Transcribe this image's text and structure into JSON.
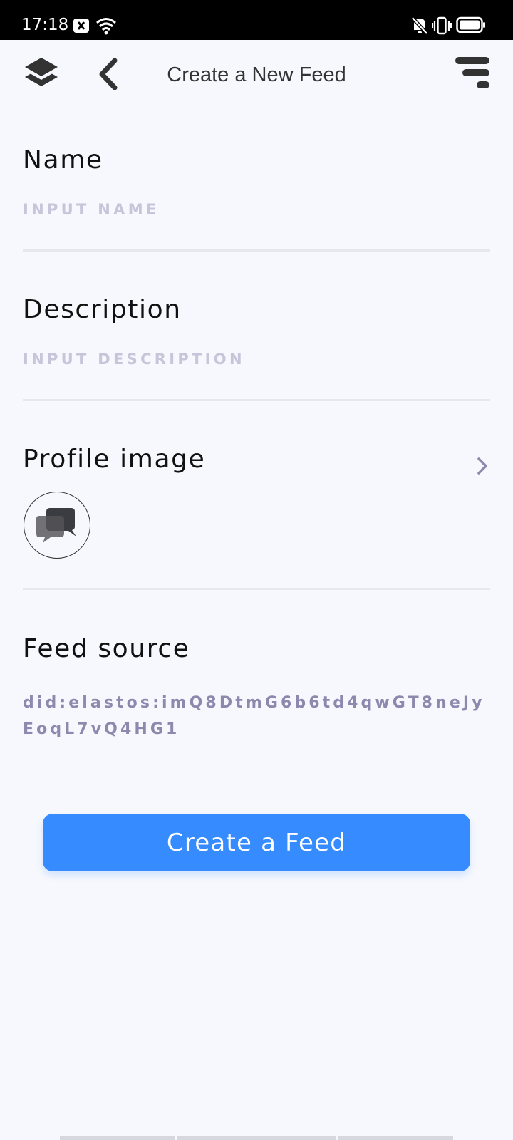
{
  "status_bar": {
    "time": "17:18",
    "icons": [
      "notification-x-icon",
      "wifi-icon",
      "mute-icon",
      "vibrate-icon",
      "battery-icon"
    ]
  },
  "header": {
    "title": "Create a New Feed",
    "left_icons": [
      "layers-icon",
      "back-icon"
    ],
    "right_icon": "menu-icon"
  },
  "form": {
    "name": {
      "label": "Name",
      "placeholder": "INPUT NAME",
      "value": ""
    },
    "description": {
      "label": "Description",
      "placeholder": "INPUT DESCRIPTION",
      "value": ""
    },
    "profile_image": {
      "label": "Profile image",
      "icon": "chat-bubbles-icon",
      "action_icon": "chevron-right-icon"
    },
    "feed_source": {
      "label": "Feed source",
      "value": "did:elastos:imQ8DtmG6b6td4qwGT8neJyEoqL7vQ4HG1"
    }
  },
  "actions": {
    "create_label": "Create a Feed"
  },
  "colors": {
    "accent": "#368BFF",
    "background": "#F6F8FD",
    "placeholder": "#C6C5D9",
    "source_text": "#8B89AE",
    "divider": "#E6E8EE"
  }
}
